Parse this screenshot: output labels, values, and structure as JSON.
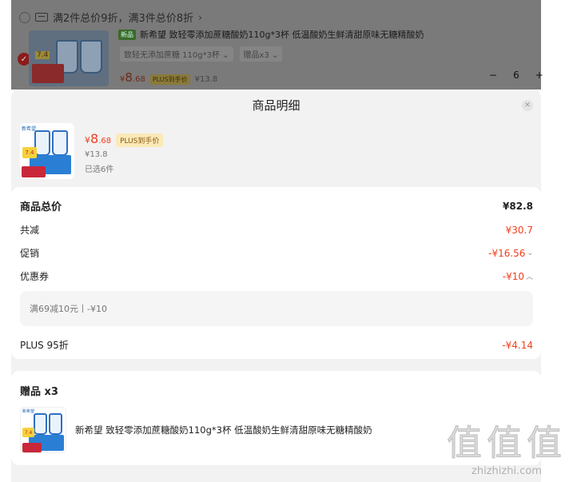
{
  "background_cart": {
    "promo_text": "满2件总价9折，满3件总价8折",
    "promo_chevron": "›",
    "product_tag": "新品",
    "product_title": "新希望 致轻零添加蔗糖酸奶110g*3杯 低温酸奶生鲜清甜原味无糖精酸奶",
    "spec_chip": "致轻无添加蔗糖 110g*3杯 ⌄",
    "gift_chip": "赠品x3 ⌄",
    "price_yen": "¥",
    "price_int": "8",
    "price_dec": ".68",
    "plus_label": "PLUS到手价",
    "orig_price": "¥13.8",
    "qty_minus": "−",
    "qty_value": "6",
    "qty_plus": "+",
    "thumb_badge": "7.4"
  },
  "sheet": {
    "title": "商品明细",
    "close_icon": "close-icon"
  },
  "product": {
    "thumb_logo": "新希望",
    "thumb_badge": "7.4",
    "price_yen": "¥",
    "price_int": "8",
    "price_dec": ".68",
    "plus_label": "PLUS到手价",
    "orig_price": "¥13.8",
    "selected_count": "已选6件"
  },
  "details": {
    "total_label": "商品总价",
    "total_value": "¥82.8",
    "reduce_label": "共减",
    "reduce_value": "¥30.7",
    "promo_label": "促销",
    "promo_value": "-¥16.56",
    "coupon_label": "优惠券",
    "coupon_value": "-¥10",
    "coupon_detail": "满69减10元丨-¥10",
    "plus_label": "PLUS 95折",
    "plus_value": "-¥4.14"
  },
  "gift": {
    "title": "赠品 x3",
    "thumb_logo": "新希望",
    "thumb_badge": "7.4",
    "name": "新希望 致轻零添加蔗糖酸奶110g*3杯 低温酸奶生鲜清甜原味无糖精酸奶"
  },
  "watermark": {
    "chars": "值值值",
    "site": "zhizhizhi.com"
  },
  "colors": {
    "accent_red": "#f0401f",
    "plus_badge_bg": "#fbe9b8",
    "sheet_bg": "#f2f2f2",
    "overlay": "#7a7a7a"
  }
}
